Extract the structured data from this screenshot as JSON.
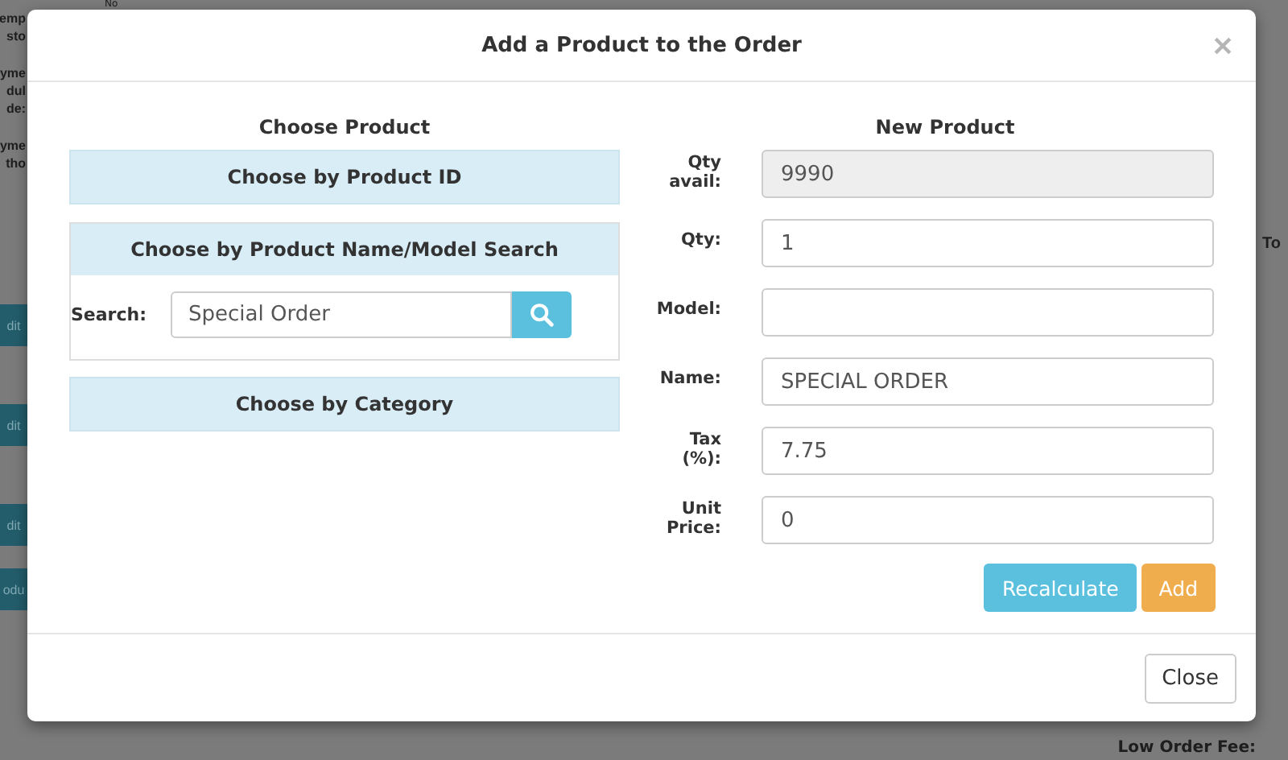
{
  "background": {
    "top_text": "No",
    "side_labels": [
      "emp",
      "sto",
      "yme",
      "dul",
      "de:",
      "yme",
      "tho"
    ],
    "side_buttons": [
      "dit",
      "dit",
      "dit",
      "odu"
    ],
    "column_heading": "To",
    "footer_label": "Low Order Fee:"
  },
  "modal": {
    "title": "Add a Product to the Order",
    "left": {
      "heading": "Choose Product",
      "sections": [
        {
          "kind": "header",
          "title": "Choose by Product ID"
        },
        {
          "kind": "search",
          "title": "Choose by Product Name/Model Search",
          "search_label": "Search:",
          "search_value": "Special Order"
        },
        {
          "kind": "header",
          "title": "Choose by Category"
        }
      ]
    },
    "right": {
      "heading": "New Product",
      "fields": [
        {
          "label": "Qty avail:",
          "value": "9990",
          "disabled": true
        },
        {
          "label": "Qty:",
          "value": "1",
          "disabled": false
        },
        {
          "label": "Model:",
          "disabled": false
        },
        {
          "label": "Name:",
          "value": "SPECIAL ORDER",
          "disabled": false
        },
        {
          "label": "Tax (%):",
          "value": "7.75",
          "disabled": false
        },
        {
          "label": "Unit Price:",
          "value": "0",
          "disabled": false
        }
      ],
      "buttons": [
        {
          "kind": "info",
          "label": "Recalculate"
        },
        {
          "kind": "warning",
          "label": "Add"
        }
      ]
    },
    "footer_buttons": [
      "Close"
    ]
  }
}
